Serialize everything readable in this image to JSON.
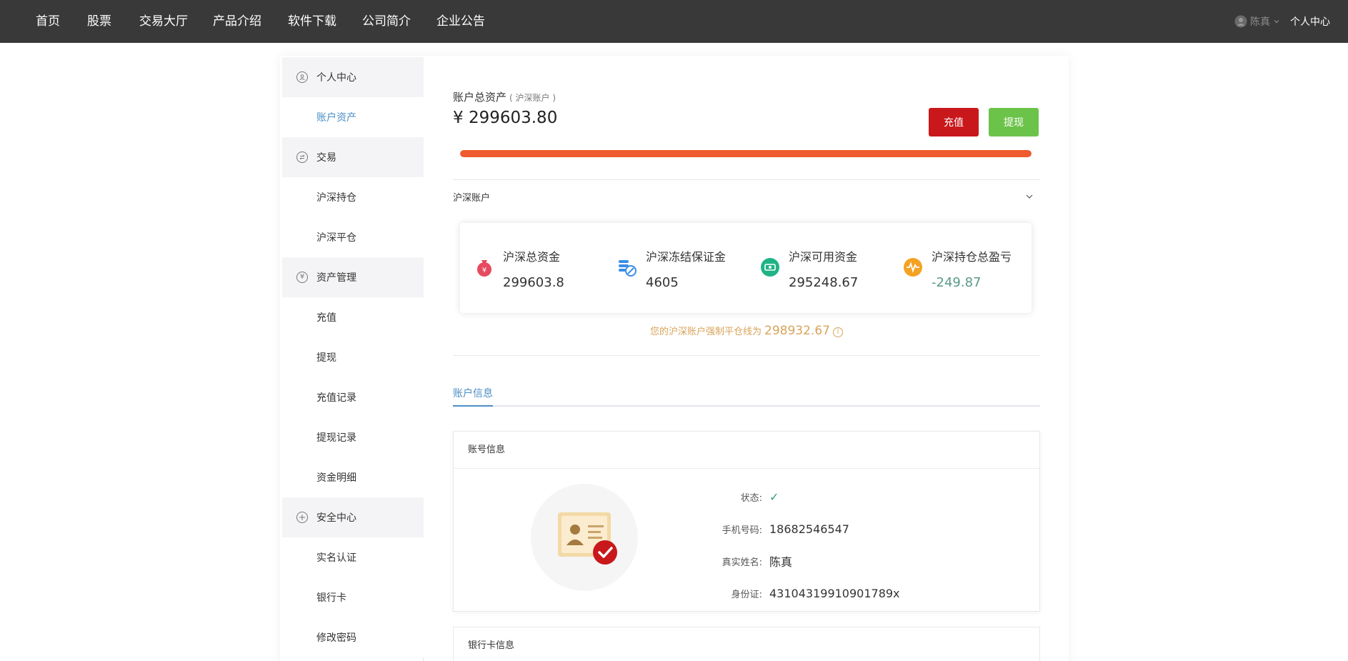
{
  "nav": {
    "items": [
      "首页",
      "股票",
      "交易大厅",
      "产品介绍",
      "软件下载",
      "公司简介",
      "企业公告"
    ],
    "user_name": "陈真",
    "user_center": "个人中心"
  },
  "sidebar": {
    "items": [
      {
        "type": "group",
        "label": "个人中心",
        "icon": "user-icon"
      },
      {
        "type": "item",
        "label": "账户资产",
        "active": true
      },
      {
        "type": "group",
        "label": "交易",
        "icon": "exchange-icon"
      },
      {
        "type": "item",
        "label": "沪深持仓"
      },
      {
        "type": "item",
        "label": "沪深平仓"
      },
      {
        "type": "group",
        "label": "资产管理",
        "icon": "yen-icon"
      },
      {
        "type": "item",
        "label": "充值"
      },
      {
        "type": "item",
        "label": "提现"
      },
      {
        "type": "item",
        "label": "充值记录"
      },
      {
        "type": "item",
        "label": "提现记录"
      },
      {
        "type": "item",
        "label": "资金明细"
      },
      {
        "type": "group",
        "label": "安全中心",
        "icon": "shield-icon"
      },
      {
        "type": "item",
        "label": "实名认证"
      },
      {
        "type": "item",
        "label": "银行卡"
      },
      {
        "type": "item",
        "label": "修改密码"
      }
    ]
  },
  "assets": {
    "title": "账户总资产",
    "subtitle": "( 沪深账户 )",
    "total": "¥ 299603.80",
    "recharge_label": "充值",
    "withdraw_label": "提现",
    "progress": 1.0,
    "progress_color": "#ef5a2e"
  },
  "account": {
    "section_label": "沪深账户",
    "stats": [
      {
        "label": "沪深总资金",
        "value": "299603.8",
        "icon": "money-bag-icon",
        "color": "#e64a5f"
      },
      {
        "label": "沪深冻结保证金",
        "value": "4605",
        "icon": "frozen-coins-icon",
        "color": "#3a8ee6"
      },
      {
        "label": "沪深可用资金",
        "value": "295248.67",
        "icon": "cash-icon",
        "color": "#1fb385"
      },
      {
        "label": "沪深持仓总盈亏",
        "value": "-249.87",
        "icon": "pulse-icon",
        "color": "#f4a223",
        "negative": true
      }
    ],
    "forced_text": "您的沪深账户强制平仓线为",
    "forced_value": "298932.67",
    "info_glyph": "i"
  },
  "tabs": {
    "active": "账户信息"
  },
  "account_info": {
    "header": "账号信息",
    "rows": [
      {
        "label": "状态:",
        "value": "✓",
        "check": true
      },
      {
        "label": "手机号码:",
        "value": "18682546547"
      },
      {
        "label": "真实姓名:",
        "value": "陈真"
      },
      {
        "label": "身份证:",
        "value": "43104319910901789x"
      }
    ]
  },
  "bank_info": {
    "header": "银行卡信息"
  }
}
